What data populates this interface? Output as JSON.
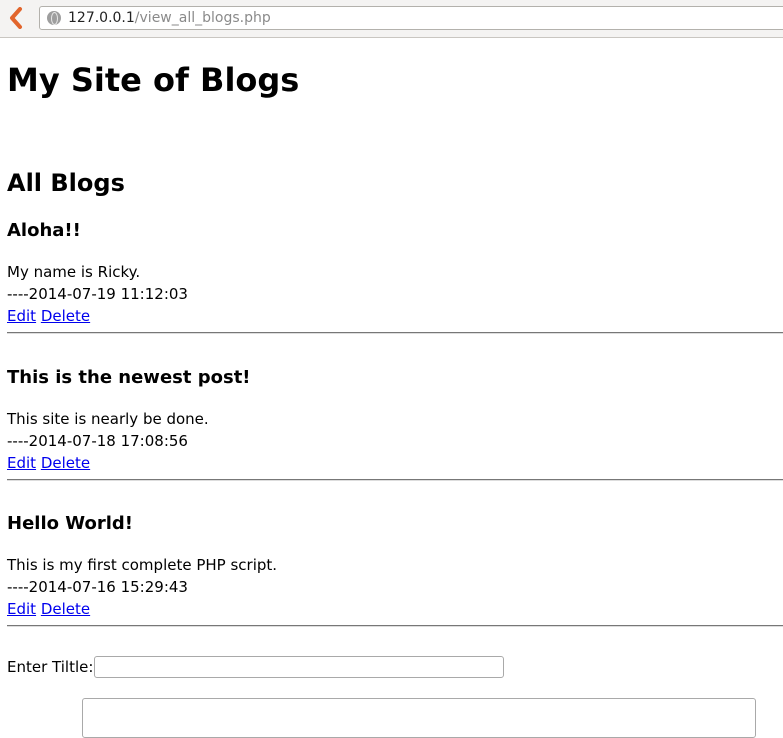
{
  "browser": {
    "url_host": "127.0.0.1",
    "url_path": "/view_all_blogs.php"
  },
  "site_title": "My Site of Blogs",
  "section_title": "All Blogs",
  "posts": [
    {
      "title": "Aloha!!",
      "body": "My name is Ricky.",
      "timestamp": "----2014-07-19 11:12:03",
      "edit_label": "Edit",
      "delete_label": "Delete"
    },
    {
      "title": "This is the newest post!",
      "body": "This site is nearly be done.",
      "timestamp": "----2014-07-18 17:08:56",
      "edit_label": "Edit",
      "delete_label": "Delete"
    },
    {
      "title": "Hello World!",
      "body": "This is my first complete PHP script.",
      "timestamp": "----2014-07-16 15:29:43",
      "edit_label": "Edit",
      "delete_label": "Delete"
    }
  ],
  "form": {
    "title_label": "Enter Tiltle:",
    "title_value": "",
    "content_value": ""
  },
  "colors": {
    "link": "#0000ee",
    "back_arrow": "#e2652c"
  }
}
